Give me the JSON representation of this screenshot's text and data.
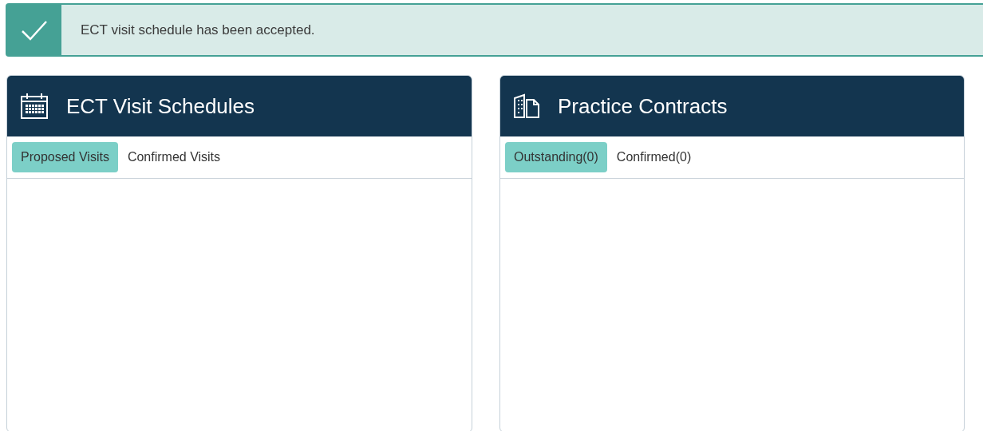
{
  "alert": {
    "kind": "success",
    "message": "ECT visit schedule has been accepted."
  },
  "panels": [
    {
      "title": "ECT Visit Schedules",
      "kind": "calendar",
      "tabs": [
        {
          "label": "Proposed Visits",
          "selected": true
        },
        {
          "label": "Confirmed Visits",
          "selected": false
        }
      ]
    },
    {
      "title": "Practice Contracts",
      "kind": "contract",
      "tabs": [
        {
          "label": "Outstanding(0)",
          "selected": true
        },
        {
          "label": "Confirmed(0)",
          "selected": false
        }
      ]
    }
  ]
}
